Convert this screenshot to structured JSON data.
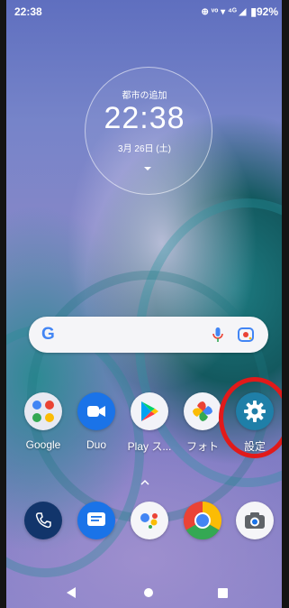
{
  "status_bar": {
    "time": "22:38",
    "indicators": "⊕ ᵛᵒ ▾ ⁴ᴳ ◢",
    "battery": "▮92%"
  },
  "clock_widget": {
    "city_label": "都市の追加",
    "time": "22:38",
    "date": "3月 26日 (土)"
  },
  "search_bar": {
    "logo": "G",
    "icons": [
      "mic-icon",
      "lens-icon"
    ]
  },
  "apps": [
    {
      "label": "Google",
      "icon": "google-folder-icon"
    },
    {
      "label": "Duo",
      "icon": "duo-camera-icon"
    },
    {
      "label": "Play ス...",
      "icon": "play-store-icon"
    },
    {
      "label": "フォト",
      "icon": "photos-pinwheel-icon"
    },
    {
      "label": "設定",
      "icon": "settings-gear-icon"
    }
  ],
  "dock": [
    {
      "icon": "phone-icon"
    },
    {
      "icon": "messages-icon"
    },
    {
      "icon": "assistant-icon"
    },
    {
      "icon": "chrome-icon"
    },
    {
      "icon": "camera-icon"
    }
  ],
  "highlight_color": "#e11a1a",
  "nav_bar": {
    "icons": [
      "back-icon",
      "home-icon",
      "recents-icon"
    ]
  }
}
